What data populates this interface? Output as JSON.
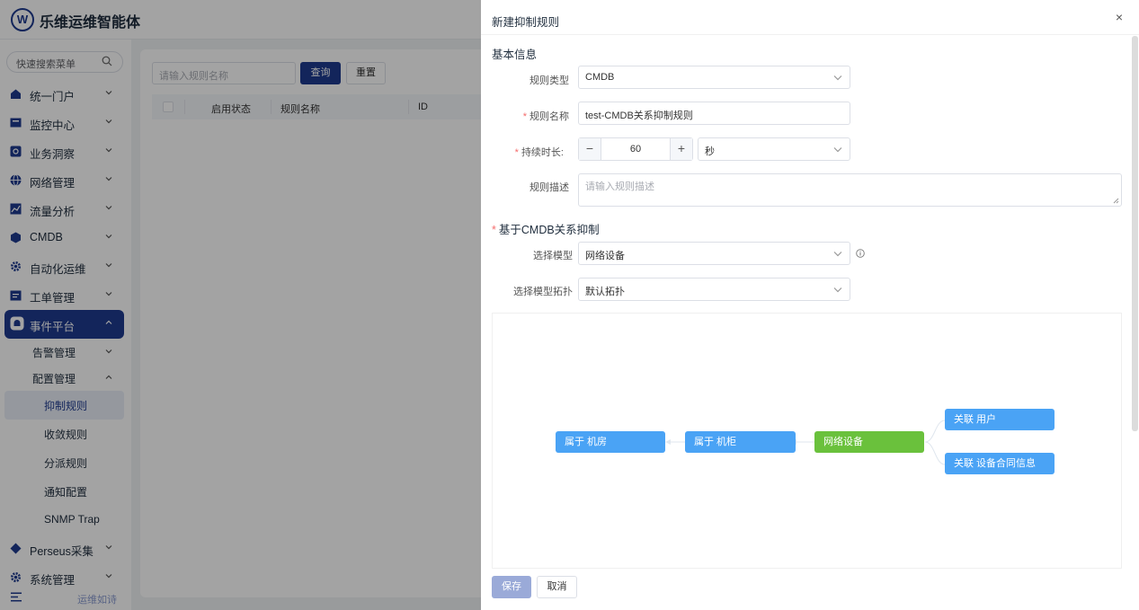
{
  "app": {
    "logo_text": "W",
    "title": "乐维运维智能体"
  },
  "sidebar": {
    "search_placeholder": "快速搜索菜单",
    "items": [
      {
        "label": "统一门户",
        "icon": "home-icon"
      },
      {
        "label": "监控中心",
        "icon": "monitor-icon"
      },
      {
        "label": "业务洞察",
        "icon": "insight-icon"
      },
      {
        "label": "网络管理",
        "icon": "globe-icon"
      },
      {
        "label": "流量分析",
        "icon": "traffic-chart-icon"
      },
      {
        "label": "CMDB",
        "icon": "cube-icon"
      },
      {
        "label": "自动化运维",
        "icon": "gear-icon"
      },
      {
        "label": "工单管理",
        "icon": "calendar-icon"
      },
      {
        "label": "事件平台",
        "icon": "bell-icon"
      }
    ],
    "event_sub": [
      {
        "label": "告警管理"
      },
      {
        "label": "配置管理"
      }
    ],
    "config_leaves": [
      {
        "label": "抑制规则"
      },
      {
        "label": "收敛规则"
      },
      {
        "label": "分派规则"
      },
      {
        "label": "通知配置"
      },
      {
        "label": "SNMP Trap"
      }
    ],
    "bottom_items": [
      {
        "label": "Perseus采集",
        "icon": "diamond-icon"
      },
      {
        "label": "系统管理",
        "icon": "settings-icon"
      }
    ],
    "footer_text": "运维如诗"
  },
  "content": {
    "search_placeholder": "请输入规则名称",
    "query_label": "查询",
    "reset_label": "重置",
    "columns": [
      "启用状态",
      "规则名称",
      "ID"
    ]
  },
  "drawer": {
    "title": "新建抑制规则",
    "close_symbol": "×",
    "basic_section": "基本信息",
    "rule_type_label": "规则类型",
    "rule_type_value": "CMDB",
    "rule_name_label": "规则名称",
    "rule_name_value": "test-CMDB关系抑制规则",
    "duration_label": "持续时长:",
    "duration_value": "60",
    "duration_minus": "−",
    "duration_plus": "+",
    "duration_unit": "秒",
    "desc_label": "规则描述",
    "desc_placeholder": "请输入规则描述",
    "cmdb_section": "基于CMDB关系抑制",
    "model_label": "选择模型",
    "model_value": "网络设备",
    "topo_label": "选择模型拓扑",
    "topo_value": "默认拓扑",
    "required_mark": "*",
    "save_label": "保存",
    "cancel_label": "取消"
  },
  "topology": {
    "nodes": {
      "room": "属于 机房",
      "cabinet": "属于 机柜",
      "device": "网络设备",
      "user": "关联 用户",
      "contract": "关联 设备合同信息"
    },
    "colors": {
      "relation": "#4aa3f5",
      "root": "#6ac13c",
      "accent": "#1f3b8f"
    }
  }
}
